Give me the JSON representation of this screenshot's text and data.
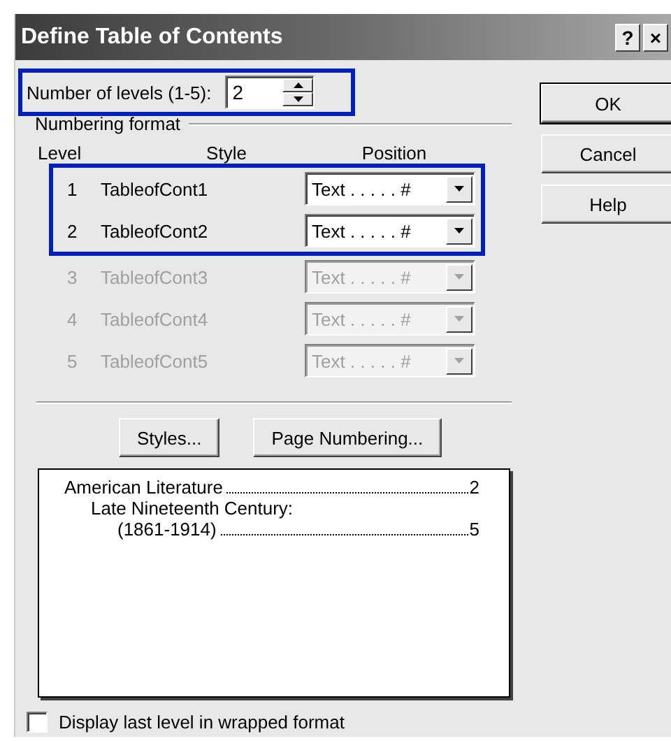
{
  "window": {
    "title": "Define Table of Contents",
    "title_buttons": [
      "?",
      "×"
    ]
  },
  "levels_field": {
    "label": "Number of levels (1-5):",
    "value": "2",
    "highlighted": true
  },
  "numbering_format": {
    "title": "Numbering format",
    "columns": [
      "Level",
      "Style",
      "Position"
    ],
    "rows": [
      {
        "level": "1",
        "style": "TableofCont1",
        "position": "Text . . . . . #",
        "disabled": false,
        "highlighted": true
      },
      {
        "level": "2",
        "style": "TableofCont2",
        "position": "Text . . . . . #",
        "disabled": false,
        "highlighted": true
      },
      {
        "level": "3",
        "style": "TableofCont3",
        "position": "Text . . . . . #",
        "disabled": true,
        "highlighted": false
      },
      {
        "level": "4",
        "style": "TableofCont4",
        "position": "Text . . . . . #",
        "disabled": true,
        "highlighted": false
      },
      {
        "level": "5",
        "style": "TableofCont5",
        "position": "Text . . . . . #",
        "disabled": true,
        "highlighted": false
      }
    ]
  },
  "middle_buttons": [
    "Styles...",
    "Page Numbering..."
  ],
  "preview": [
    {
      "text": "American Literature",
      "page": "2",
      "children": [
        {
          "text": "Late Nineteenth Century:",
          "children": [
            {
              "text": "(1861-1914)",
              "page": "5"
            }
          ]
        }
      ]
    }
  ],
  "wrap_checkbox": {
    "label": "Display last level in wrapped format",
    "checked": false
  },
  "side_buttons": [
    {
      "label": "OK",
      "default": true
    },
    {
      "label": "Cancel",
      "default": false
    },
    {
      "label": "Help",
      "default": false
    }
  ]
}
